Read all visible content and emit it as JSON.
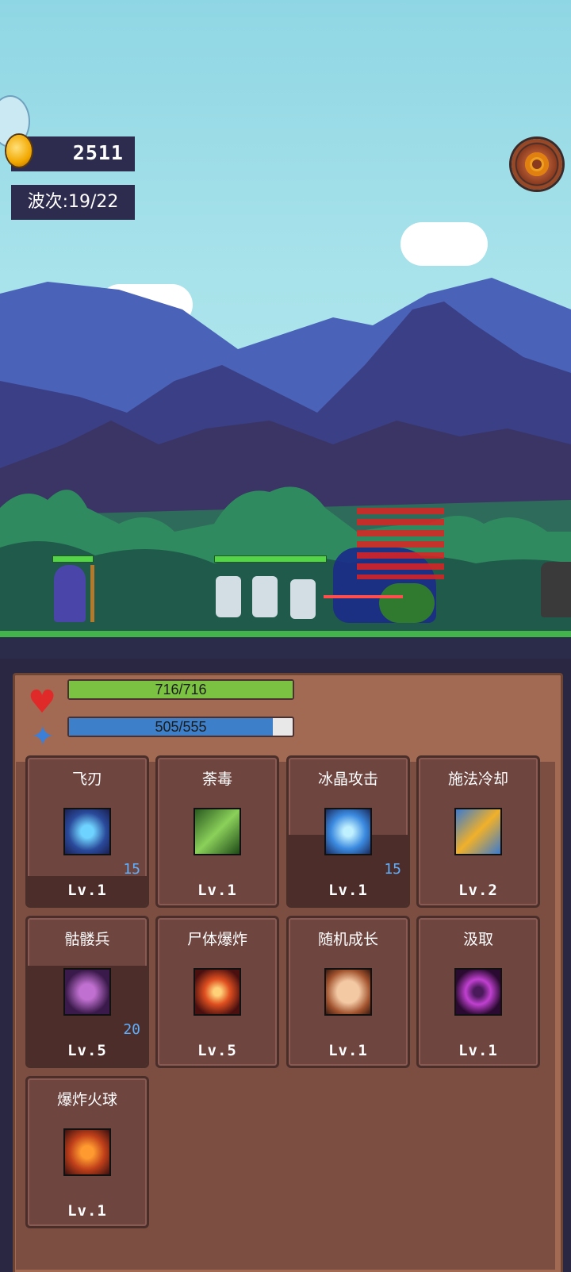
{
  "hud": {
    "coins": "2511",
    "wave": "波次:19/22"
  },
  "stats": {
    "hp_text": "716/716",
    "hp_fraction": 1.0,
    "mana_text": "505/555",
    "mana_fraction": 0.91
  },
  "skills": [
    {
      "name": "飞刃",
      "level": "Lv.1",
      "count": "15",
      "icon": "blade-icon",
      "cooldown": 0.2
    },
    {
      "name": "荼毒",
      "level": "Lv.1",
      "count": "",
      "icon": "poison-icon",
      "cooldown": 0
    },
    {
      "name": "冰晶攻击",
      "level": "Lv.1",
      "count": "15",
      "icon": "ice-crystal-icon",
      "cooldown": 0.48
    },
    {
      "name": "施法冷却",
      "level": "Lv.2",
      "count": "",
      "icon": "lightning-icon",
      "cooldown": 0
    },
    {
      "name": "骷髅兵",
      "level": "Lv.5",
      "count": "20",
      "icon": "skeleton-hand-icon",
      "cooldown": 0.68
    },
    {
      "name": "尸体爆炸",
      "level": "Lv.5",
      "count": "",
      "icon": "explosion-icon",
      "cooldown": 0
    },
    {
      "name": "随机成长",
      "level": "Lv.1",
      "count": "",
      "icon": "fist-icon",
      "cooldown": 0
    },
    {
      "name": "汲取",
      "level": "Lv.1",
      "count": "",
      "icon": "vortex-icon",
      "cooldown": 0
    },
    {
      "name": "爆炸火球",
      "level": "Lv.1",
      "count": "",
      "icon": "fireball-icon",
      "cooldown": 0
    }
  ],
  "colors": {
    "hp": "#7cc242",
    "mana": "#3d7fc8",
    "panel": "#a26a52"
  }
}
